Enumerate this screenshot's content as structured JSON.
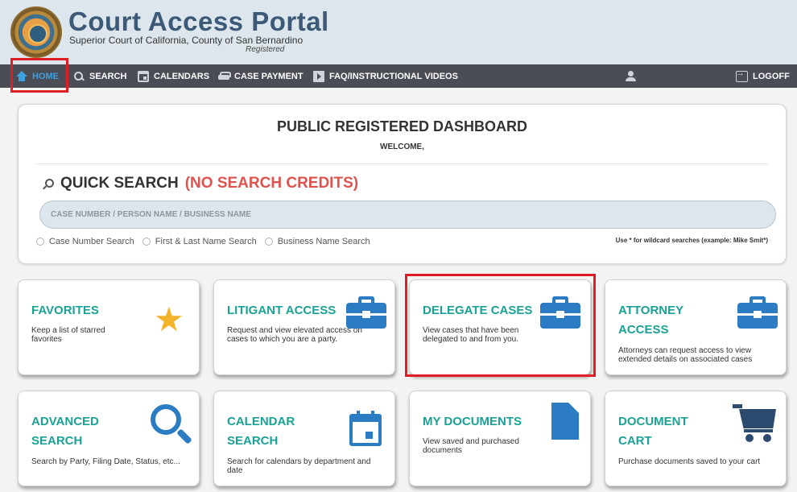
{
  "header": {
    "title": "Court Access Portal",
    "subtitle": "Superior Court of California, County of San Bernardino",
    "status": "Registered",
    "logo": "court-seal"
  },
  "nav": {
    "items": [
      {
        "label": "HOME",
        "icon": "home-icon",
        "active": true
      },
      {
        "label": "SEARCH",
        "icon": "search-icon"
      },
      {
        "label": "CALENDARS",
        "icon": "calendar-icon"
      },
      {
        "label": "CASE PAYMENT",
        "icon": "car-icon"
      },
      {
        "label": "FAQ/INSTRUCTIONAL VIDEOS",
        "icon": "video-icon"
      }
    ],
    "user_icon": "user-icon",
    "logoff_label": "LOGOFF"
  },
  "dashboard": {
    "title": "PUBLIC REGISTERED DASHBOARD",
    "welcome": "WELCOME,",
    "quick_search": {
      "title": "QUICK SEARCH",
      "note": "(NO SEARCH CREDITS)",
      "placeholder": "CASE NUMBER / PERSON NAME / BUSINESS NAME",
      "options": [
        "Case Number Search",
        "First & Last Name Search",
        "Business Name Search"
      ],
      "wildcard_hint": "Use * for wildcard searches (example: Mike Smit*)"
    }
  },
  "cards": [
    {
      "title": "FAVORITES",
      "description": "Keep a list of starred favorites",
      "icon": "star-icon"
    },
    {
      "title": "LITIGANT ACCESS",
      "description": "Request and view elevated access on cases to which you are a party.",
      "icon": "briefcase-icon"
    },
    {
      "title": "DELEGATE CASES",
      "description": "View cases that have been delegated to and from you.",
      "icon": "briefcase-icon"
    },
    {
      "title": "ATTORNEY ACCESS",
      "description": "Attorneys can request access to view extended details on associated cases",
      "icon": "briefcase-icon"
    },
    {
      "title": "ADVANCED SEARCH",
      "description": "Search by Party, Filing Date, Status, etc...",
      "icon": "magnifier-icon"
    },
    {
      "title": "CALENDAR SEARCH",
      "description": "Search for calendars by department and date",
      "icon": "calendar-icon"
    },
    {
      "title": "MY DOCUMENTS",
      "description": "View saved and purchased documents",
      "icon": "document-icon"
    },
    {
      "title": "DOCUMENT CART",
      "description": "Purchase documents saved to your cart",
      "icon": "cart-icon"
    }
  ],
  "colors": {
    "accent": "#1aa295",
    "nav_bg": "#4a4d55",
    "active_nav": "#3ea0df",
    "highlight": "#e01e25",
    "warning": "#e0524e",
    "icon_blue": "#2b7cc2"
  }
}
